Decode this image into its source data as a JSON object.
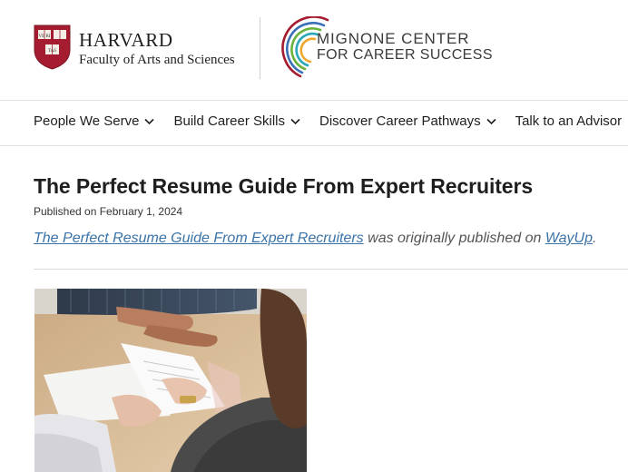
{
  "header": {
    "harvard_name": "HARVARD",
    "harvard_sub": "Faculty of Arts and Sciences",
    "shield_text_1": "VE RI",
    "shield_text_2": "TAS",
    "center_line1": "MIGNONE CENTER",
    "center_line2": "FOR CAREER SUCCESS",
    "brand_color": "#a51c30"
  },
  "nav": {
    "items": [
      {
        "label": "People We Serve",
        "has_dropdown": true
      },
      {
        "label": "Build Career Skills",
        "has_dropdown": true
      },
      {
        "label": "Discover Career Pathways",
        "has_dropdown": true
      },
      {
        "label": "Talk to an Advisor",
        "has_dropdown": false
      }
    ]
  },
  "article": {
    "title": "The Perfect Resume Guide From Expert Recruiters",
    "published": "Published on February 1, 2024",
    "intro_link": "The Perfect Resume Guide From Expert Recruiters",
    "intro_middle": " was originally published on ",
    "intro_source": "WayUp",
    "intro_end": ".",
    "link_color": "#3b73a8"
  }
}
